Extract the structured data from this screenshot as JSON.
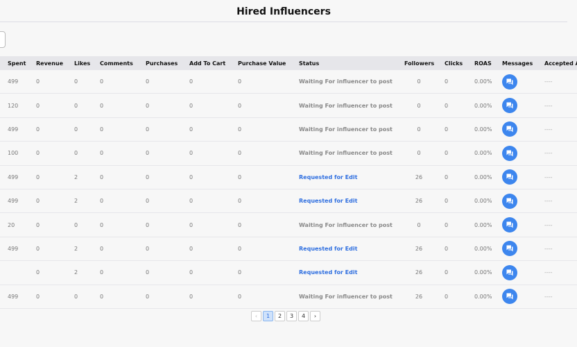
{
  "title": "Hired Influencers",
  "headers": [
    "Spent",
    "Revenue",
    "Likes",
    "Comments",
    "Purchases",
    "Add To Cart",
    "Purchase Value",
    "Status",
    "Followers",
    "Clicks",
    "ROAS",
    "Messages",
    "Accepted A"
  ],
  "rows": [
    {
      "spent": "499",
      "revenue": "0",
      "likes": "0",
      "comments": "0",
      "purchases": "0",
      "add_to_cart": "0",
      "purchase_value": "0",
      "status": "Waiting For influencer to post",
      "followers": "0",
      "clicks": "0",
      "roas": "0.00%",
      "accepted": "----"
    },
    {
      "spent": "120",
      "revenue": "0",
      "likes": "0",
      "comments": "0",
      "purchases": "0",
      "add_to_cart": "0",
      "purchase_value": "0",
      "status": "Waiting For influencer to post",
      "followers": "0",
      "clicks": "0",
      "roas": "0.00%",
      "accepted": "----"
    },
    {
      "spent": "499",
      "revenue": "0",
      "likes": "0",
      "comments": "0",
      "purchases": "0",
      "add_to_cart": "0",
      "purchase_value": "0",
      "status": "Waiting For influencer to post",
      "followers": "0",
      "clicks": "0",
      "roas": "0.00%",
      "accepted": "----"
    },
    {
      "spent": "100",
      "revenue": "0",
      "likes": "0",
      "comments": "0",
      "purchases": "0",
      "add_to_cart": "0",
      "purchase_value": "0",
      "status": "Waiting For influencer to post",
      "followers": "0",
      "clicks": "0",
      "roas": "0.00%",
      "accepted": "----"
    },
    {
      "spent": "499",
      "revenue": "0",
      "likes": "2",
      "comments": "0",
      "purchases": "0",
      "add_to_cart": "0",
      "purchase_value": "0",
      "status": "Requested for Edit",
      "followers": "26",
      "clicks": "0",
      "roas": "0.00%",
      "accepted": "----"
    },
    {
      "spent": "499",
      "revenue": "0",
      "likes": "2",
      "comments": "0",
      "purchases": "0",
      "add_to_cart": "0",
      "purchase_value": "0",
      "status": "Requested for Edit",
      "followers": "26",
      "clicks": "0",
      "roas": "0.00%",
      "accepted": "----"
    },
    {
      "spent": "20",
      "revenue": "0",
      "likes": "0",
      "comments": "0",
      "purchases": "0",
      "add_to_cart": "0",
      "purchase_value": "0",
      "status": "Waiting For influencer to post",
      "followers": "0",
      "clicks": "0",
      "roas": "0.00%",
      "accepted": "----"
    },
    {
      "spent": "499",
      "revenue": "0",
      "likes": "2",
      "comments": "0",
      "purchases": "0",
      "add_to_cart": "0",
      "purchase_value": "0",
      "status": "Requested for Edit",
      "followers": "26",
      "clicks": "0",
      "roas": "0.00%",
      "accepted": "----"
    },
    {
      "spent": "",
      "revenue": "0",
      "likes": "2",
      "comments": "0",
      "purchases": "0",
      "add_to_cart": "0",
      "purchase_value": "0",
      "status": "Requested for Edit",
      "followers": "26",
      "clicks": "0",
      "roas": "0.00%",
      "accepted": "----"
    },
    {
      "spent": "499",
      "revenue": "0",
      "likes": "0",
      "comments": "0",
      "purchases": "0",
      "add_to_cart": "0",
      "purchase_value": "0",
      "status": "Waiting For influencer to post",
      "followers": "26",
      "clicks": "0",
      "roas": "0.00%",
      "accepted": "----"
    }
  ],
  "pagination": {
    "prev": "‹",
    "pages": [
      "1",
      "2",
      "3",
      "4"
    ],
    "next": "›",
    "current": "1"
  },
  "colors": {
    "accent": "#3d86ee",
    "edit_status": "#2f6fe0"
  }
}
